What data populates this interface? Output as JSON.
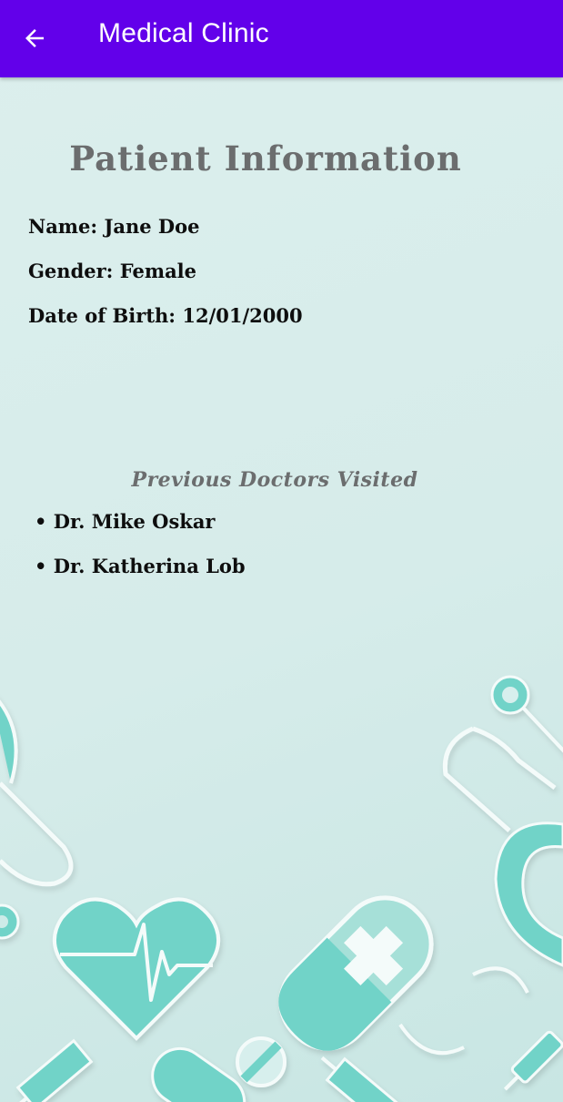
{
  "app_bar": {
    "title": "Medical Clinic",
    "back_icon": "arrow-back-icon",
    "color": "#6200ea"
  },
  "patient": {
    "heading": "Patient Information",
    "name_line": "Name: Jane Doe",
    "gender_line": "Gender: Female",
    "dob_line": "Date of Birth: 12/01/2000"
  },
  "doctors": {
    "heading": "Previous Doctors Visited",
    "items": [
      "• Dr. Mike Oskar",
      "• Dr. Katherina Lob"
    ]
  },
  "theme": {
    "background": "#d6ecea",
    "accent_teal": "#71d3c8",
    "heading_grey": "#6b6d6e"
  },
  "decoration_icons": [
    "stethoscope-icon",
    "heart-ecg-icon",
    "pill-capsule-icon",
    "first-aid-kit-icon",
    "syringe-icon",
    "tablet-icon"
  ]
}
